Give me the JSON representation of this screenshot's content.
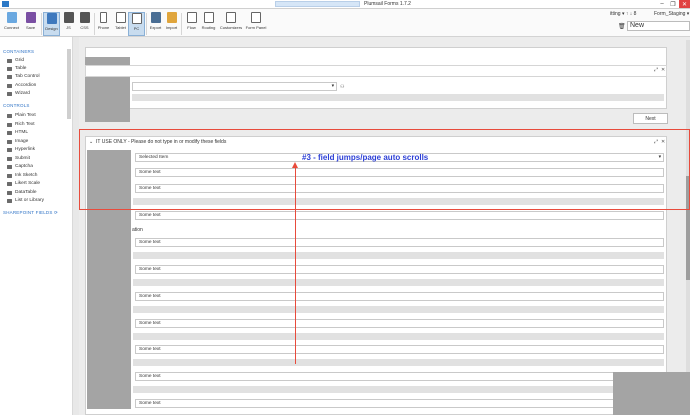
{
  "window": {
    "title": "Plumsail Forms 1.7.2",
    "controls": {
      "minimize": "–",
      "maximize": "❐",
      "close": "✕"
    }
  },
  "ribbon": {
    "buttons": [
      {
        "label": "Connect"
      },
      {
        "label": "Save"
      },
      {
        "label": "Design"
      },
      {
        "label": "JS"
      },
      {
        "label": "CSS"
      },
      {
        "label": "Phone"
      },
      {
        "label": "Tablet"
      },
      {
        "label": "PC"
      },
      {
        "label": "Export"
      },
      {
        "label": "Import"
      },
      {
        "label": "Flow"
      },
      {
        "label": "Routing"
      },
      {
        "label": "Customizers"
      },
      {
        "label": "Form Panel"
      }
    ],
    "right": {
      "settings": "itting ▾ ↑ ↓ 8",
      "form_select": "Form_Staging ▾",
      "new_label": "New"
    }
  },
  "sidebar": {
    "containers_title": "CONTAINERS",
    "containers": [
      "Grid",
      "Table",
      "Tab Control",
      "Accordion",
      "Wizard"
    ],
    "controls_title": "CONTROLS",
    "controls": [
      "Plain Text",
      "Rich Text",
      "HTML",
      "Image",
      "Hyperlink",
      "Submit",
      "Captcha",
      "Ink Sketch",
      "Likert Scale",
      "DataTable",
      "List or Library"
    ],
    "sharepoint_title": "SHAREPOINT FIELDS"
  },
  "canvas": {
    "next_button": "Next",
    "it_panel_header": "IT USE ONLY - Please do not type in or modify these fields",
    "selected_item": "Selected Item",
    "field_text": "Some text",
    "partial_label": "ation",
    "annotation": "#3 - field jumps/page auto scrolls"
  }
}
